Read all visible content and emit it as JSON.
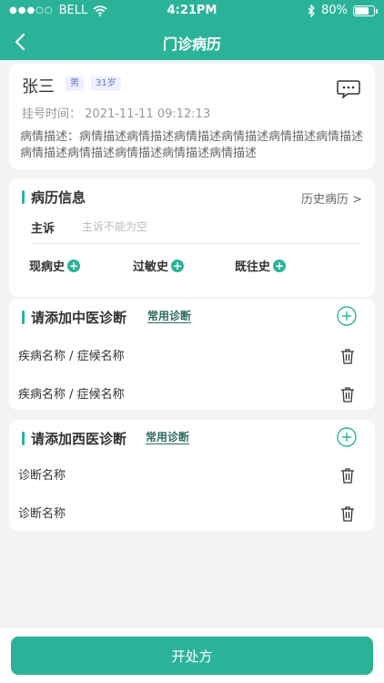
{
  "status_bar": {
    "carrier": "BELL",
    "time": "4:21PM",
    "battery": "80%",
    "battery_level": 0.8
  },
  "nav": {
    "title": "门诊病历"
  },
  "patient": {
    "name": "张三",
    "gender": "男",
    "age": "31岁",
    "reg_label": "挂号时间：",
    "reg_time": "2021-11-11 09:12:13",
    "description": "病情描述：病情描述病情描述病情描述病情描述病情描述病情描述病情描述病情描述病情描述病情描述病情描述"
  },
  "record": {
    "title": "病历信息",
    "history_link": "历史病历 >",
    "complaint_label": "主诉",
    "complaint_placeholder": "主诉不能为空",
    "items": [
      "现病史",
      "过敏史",
      "既往史"
    ]
  },
  "tcm": {
    "title": "请添加中医诊断",
    "common_link": "常用诊断",
    "rows": [
      "疾病名称 / 症候名称",
      "疾病名称 / 症候名称"
    ]
  },
  "western": {
    "title": "请添加西医诊断",
    "common_link": "常用诊断",
    "rows": [
      "诊断名称",
      "诊断名称"
    ]
  },
  "footer": {
    "button_label": "开处方"
  },
  "colors": {
    "primary": "#2bb39a",
    "background": "#f2f3f5",
    "tag_bg": "#eef0ff",
    "tag_text": "#6a74d6"
  },
  "icons": [
    "wifi-icon",
    "bluetooth-icon",
    "battery-icon",
    "back-arrow-icon",
    "message-icon",
    "plus-circle-icon",
    "add-circle-icon",
    "trash-icon"
  ]
}
